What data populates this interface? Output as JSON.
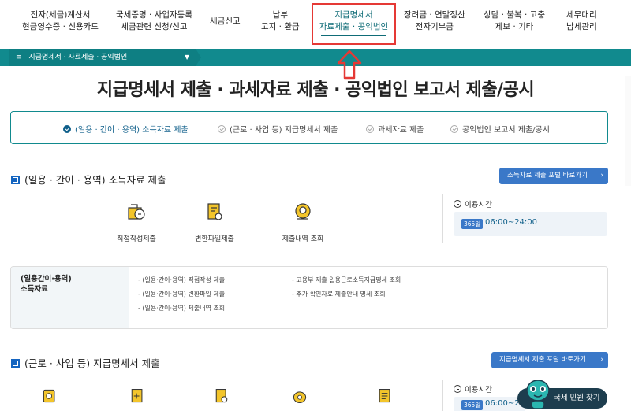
{
  "nav": {
    "items": [
      {
        "line1": "전자(세금)계산서",
        "line2": "현금영수증 · 신용카드"
      },
      {
        "line1": "국세증명 · 사업자등록",
        "line2": "세금관련 신청/신고"
      },
      {
        "line1": "세금신고",
        "line2": ""
      },
      {
        "line1": "납부",
        "line2": "고지 · 환급"
      },
      {
        "line1": "장려금 · 연말정산",
        "line2": "전자기부금"
      },
      {
        "line1": "상담 · 불복 · 고충",
        "line2": "제보 · 기타"
      },
      {
        "line1": "세무대리",
        "line2": "납세관리"
      }
    ],
    "active": {
      "line1": "지급명세서",
      "line2": "자료제출 · 공익법인"
    }
  },
  "breadcrumb": {
    "label": "지급명세서 · 자료제출 · 공익법인"
  },
  "page_title": "지급명세서 제출 · 과세자료 제출 · 공익법인 보고서 제출/공시",
  "tabs": [
    {
      "label": "(일용 · 간이 · 용역) 소득자료 제출",
      "active": true
    },
    {
      "label": "(근로 · 사업 등) 지급명세서 제출",
      "active": false
    },
    {
      "label": "과세자료 제출",
      "active": false
    },
    {
      "label": "공익법인 보고서 제출/공시",
      "active": false
    }
  ],
  "section1": {
    "title": "(일용 · 간이 · 용역) 소득자료 제출",
    "portal_button": "소득자료 제출 포털 바로가기",
    "services": [
      {
        "label": "직접작성제출",
        "icon": "pen-document-icon"
      },
      {
        "label": "변환파일제출",
        "icon": "file-convert-icon"
      },
      {
        "label": "제출내역 조회",
        "icon": "search-history-icon"
      }
    ],
    "time": {
      "title": "이용시간",
      "badge": "365일",
      "value": "06:00~24:00"
    },
    "info": {
      "category_line1": "(일용간이·용역)",
      "category_line2": "소득자료",
      "links_col1": [
        "- (일용·간이·용역) 직접작성 제출",
        "- (일용·간이·용역) 변환파일 제출",
        "- (일용·간이·용역) 제출내역 조회"
      ],
      "links_col2": [
        "- 고용부 제출 일용근로소득지급명세 조회",
        "- 추가 확인자료 제출안내 명세 조회"
      ]
    }
  },
  "section2": {
    "title": "(근로 · 사업 등) 지급명세서 제출",
    "portal_button": "지급명세서 제출 포털 바로가기",
    "time": {
      "title": "이용시간",
      "badge": "365일",
      "value": "06:00~24:00"
    }
  },
  "chatbot": {
    "label": "국세 민원 찾기"
  },
  "colors": {
    "teal": "#118a8e",
    "accent_blue": "#3a78c8",
    "highlight_red": "#e53935"
  }
}
